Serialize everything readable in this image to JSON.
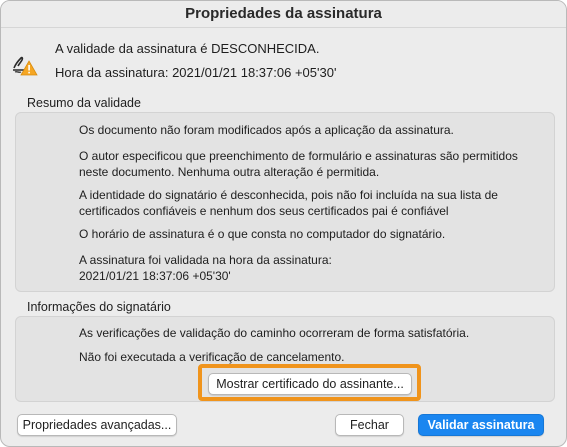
{
  "window": {
    "title": "Propriedades da assinatura"
  },
  "status": {
    "icon": "signature-warning-icon",
    "validity": "A validade da assinatura é DESCONHECIDA.",
    "signing_time": "Hora da assinatura: 2021/01/21 18:37:06 +05'30'"
  },
  "validity_summary": {
    "label": "Resumo da validade",
    "items": [
      "Os documento não foram modificados após a aplicação da assinatura.",
      "O autor especificou que preenchimento de formulário e assinaturas são permitidos neste documento. Nenhuma outra alteração é permitida.",
      "A identidade do signatário é desconhecida, pois não foi incluída na sua lista de certificados confiáveis e nenhum dos seus certificados pai é confiável",
      "O horário de assinatura é o que consta no computador do signatário.",
      "A assinatura foi validada na hora da assinatura:\n2021/01/21 18:37:06 +05'30'"
    ]
  },
  "signer_info": {
    "label": "Informações do signatário",
    "items": [
      "As verificações de validação do caminho ocorreram de forma satisfatória.",
      "Não foi executada a verificação de cancelamento."
    ],
    "show_certificate_button": "Mostrar certificado do assinante..."
  },
  "footer": {
    "advanced_button": "Propriedades avançadas...",
    "close_button": "Fechar",
    "validate_button": "Validar assinatura"
  },
  "colors": {
    "accent": "#1a86f0",
    "highlight": "#f0941c",
    "warning": "#f5a623"
  }
}
